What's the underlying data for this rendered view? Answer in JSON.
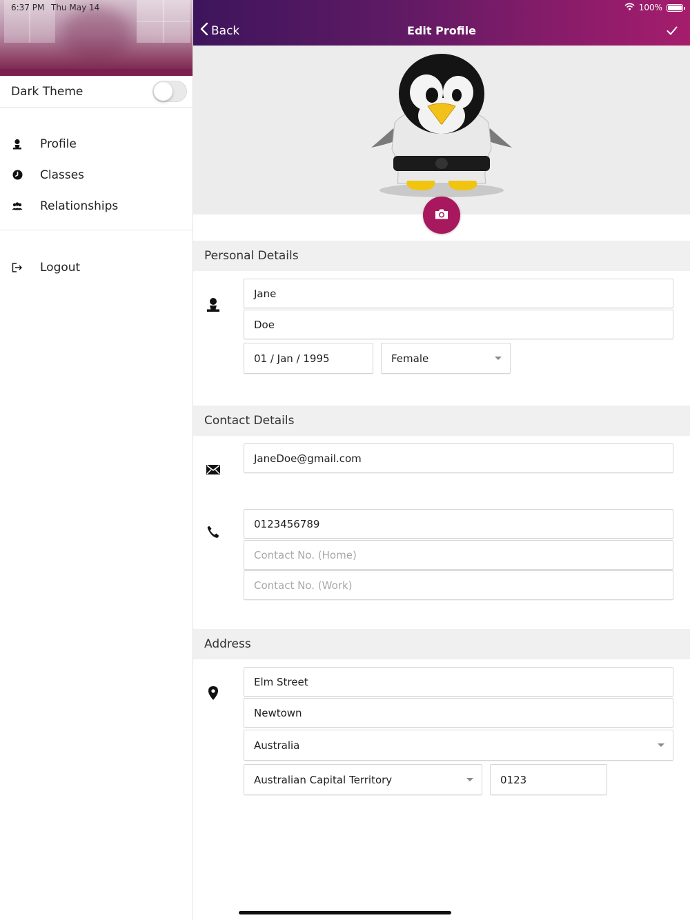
{
  "status_bar": {
    "time": "6:37 PM",
    "date": "Thu May 14",
    "battery_percent": "100%"
  },
  "sidebar": {
    "dark_theme_label": "Dark Theme",
    "dark_theme_enabled": false,
    "items": [
      {
        "label": "Profile",
        "icon": "person-icon"
      },
      {
        "label": "Classes",
        "icon": "clock-icon"
      },
      {
        "label": "Relationships",
        "icon": "group-icon"
      }
    ],
    "logout": {
      "label": "Logout",
      "icon": "logout-icon"
    }
  },
  "navbar": {
    "back_label": "Back",
    "title": "Edit Profile",
    "confirm_icon": "checkmark-icon"
  },
  "profile_photo": {
    "camera_icon": "camera-icon"
  },
  "personal_details": {
    "header": "Personal Details",
    "first_name": "Jane",
    "last_name": "Doe",
    "dob": "01 / Jan / 1995",
    "gender": "Female"
  },
  "contact_details": {
    "header": "Contact Details",
    "email": "JaneDoe@gmail.com",
    "mobile": "0123456789",
    "home_placeholder": "Contact No. (Home)",
    "work_placeholder": "Contact No. (Work)"
  },
  "address": {
    "header": "Address",
    "street": "Elm Street",
    "suburb": "Newtown",
    "country": "Australia",
    "state": "Australian Capital Territory",
    "postcode": "0123"
  },
  "colors": {
    "accent": "#a8185e",
    "navbar_start": "#3d155c",
    "navbar_end": "#a51d6c"
  }
}
